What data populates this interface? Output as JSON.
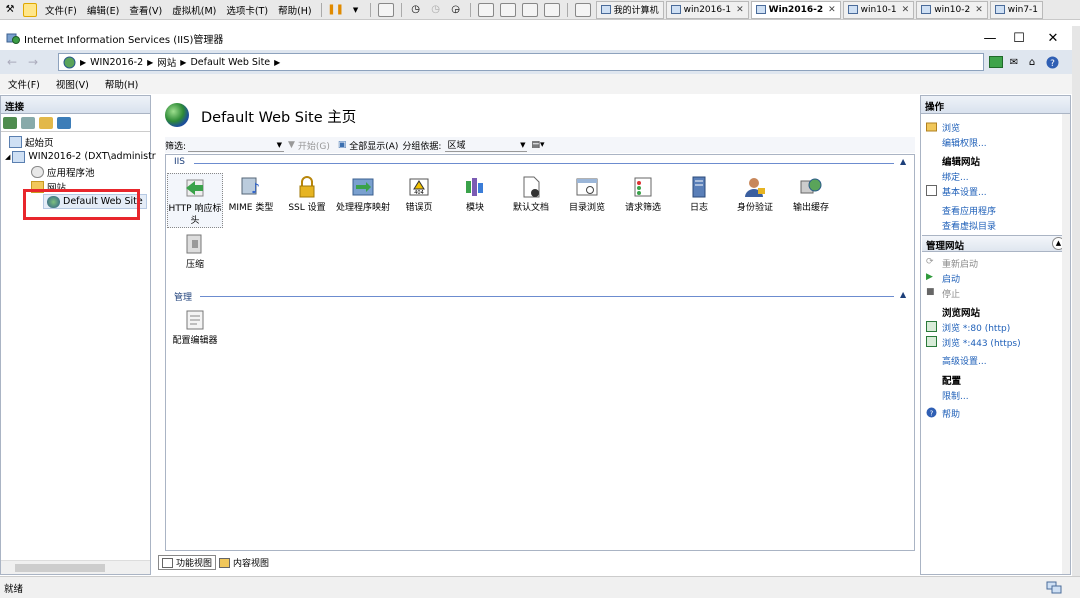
{
  "vmware": {
    "menus": [
      "文件(F)",
      "编辑(E)",
      "查看(V)",
      "虚拟机(M)",
      "选项卡(T)",
      "帮助(H)"
    ],
    "tabs": [
      {
        "label": "我的计算机",
        "active": false
      },
      {
        "label": "win2016-1",
        "active": false
      },
      {
        "label": "Win2016-2",
        "active": true
      },
      {
        "label": "win10-1",
        "active": false
      },
      {
        "label": "win10-2",
        "active": false
      },
      {
        "label": "win7-1",
        "active": false
      }
    ],
    "close_glyph": "✕"
  },
  "window": {
    "title": "Internet Information Services (IIS)管理器",
    "minimize": "—",
    "maximize": "☐",
    "close": "✕"
  },
  "address": {
    "crumbs": [
      "WIN2016-2",
      "网站",
      "Default Web Site"
    ]
  },
  "menubar": [
    "文件(F)",
    "视图(V)",
    "帮助(H)"
  ],
  "connections": {
    "header": "连接",
    "tree": [
      {
        "label": "起始页"
      },
      {
        "label": "WIN2016-2 (DXT\\administr"
      },
      {
        "label": "应用程序池"
      },
      {
        "label": "网站"
      },
      {
        "label": "Default Web Site"
      }
    ]
  },
  "main": {
    "title": "Default Web Site 主页",
    "filter_label": "筛选:",
    "start_label": "开始(G)",
    "show_all_label": "全部显示(A)",
    "group_label": "分组依据:",
    "group_value": "区域",
    "groups": [
      {
        "name": "IIS",
        "features": [
          "HTTP 响应标头",
          "MIME 类型",
          "SSL 设置",
          "处理程序映射",
          "错误页",
          "模块",
          "默认文档",
          "目录浏览",
          "请求筛选",
          "日志",
          "身份验证",
          "输出缓存",
          "压缩"
        ]
      },
      {
        "name": "管理",
        "features": [
          "配置编辑器"
        ]
      }
    ],
    "view_tabs": [
      "功能视图",
      "内容视图"
    ]
  },
  "actions": {
    "header": "操作",
    "top_links": [
      "浏览",
      "编辑权限..."
    ],
    "edit_site_title": "编辑网站",
    "edit_links": [
      "绑定...",
      "基本设置...",
      "查看应用程序",
      "查看虚拟目录"
    ],
    "manage_header": "管理网站",
    "manage_links": [
      "重新启动",
      "启动",
      "停止"
    ],
    "browse_title": "浏览网站",
    "browse_links": [
      "浏览 *:80 (http)",
      "浏览 *:443 (https)"
    ],
    "advanced_link": "高级设置...",
    "config_title": "配置",
    "limits_link": "限制...",
    "help_link": "帮助"
  },
  "status": {
    "text": "就绪"
  },
  "colors": {
    "link": "#1e5fb8",
    "highlight_box": "#e8262c",
    "group_header": "#1d3f7a"
  }
}
